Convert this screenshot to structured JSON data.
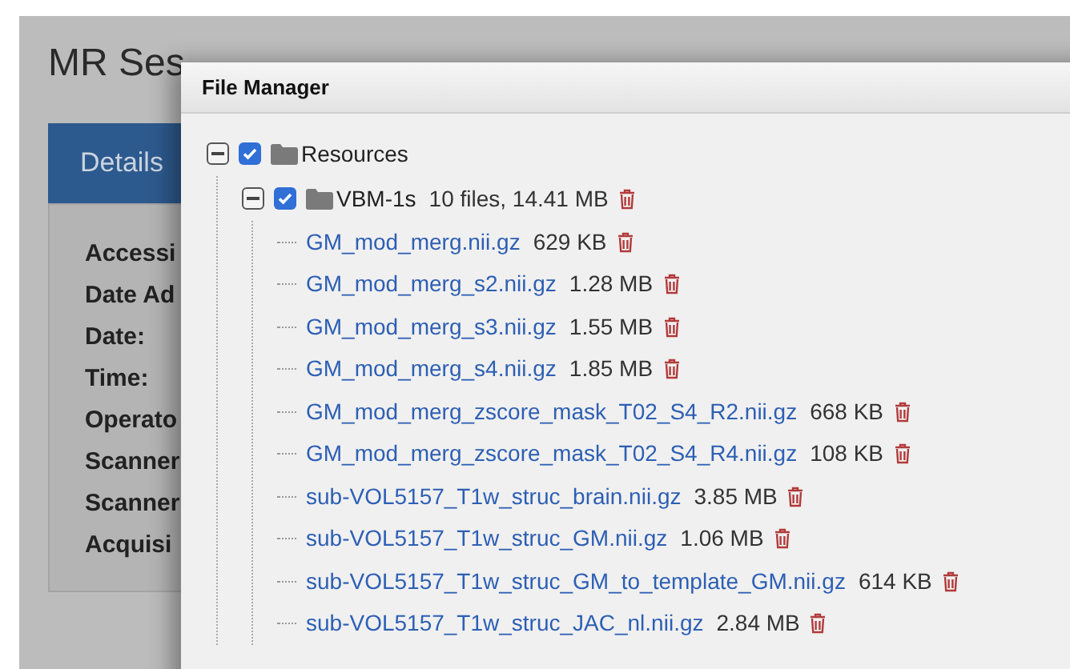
{
  "page": {
    "title": "MR Ses",
    "tabs": [
      {
        "label": "Details",
        "selected": true
      }
    ],
    "field_labels": [
      "Accessi",
      "Date Ad",
      "Date:",
      "Time:",
      "Operato",
      "Scanner",
      "Scanner",
      "Acquisi"
    ]
  },
  "file_manager": {
    "title": "File Manager",
    "tree": [
      {
        "kind": "folder",
        "name": "Resources",
        "expanded": true,
        "checked": true,
        "children": [
          {
            "kind": "folder",
            "name": "VBM-1s",
            "info": "10 files, 14.41 MB",
            "expanded": true,
            "checked": true,
            "children": [
              {
                "kind": "file",
                "name": "GM_mod_merg.nii.gz",
                "size": "629 KB"
              },
              {
                "kind": "file",
                "name": "GM_mod_merg_s2.nii.gz",
                "size": "1.28 MB"
              },
              {
                "kind": "file",
                "name": "GM_mod_merg_s3.nii.gz",
                "size": "1.55 MB"
              },
              {
                "kind": "file",
                "name": "GM_mod_merg_s4.nii.gz",
                "size": "1.85 MB"
              },
              {
                "kind": "file",
                "name": "GM_mod_merg_zscore_mask_T02_S4_R2.nii.gz",
                "size": "668 KB"
              },
              {
                "kind": "file",
                "name": "GM_mod_merg_zscore_mask_T02_S4_R4.nii.gz",
                "size": "108 KB"
              },
              {
                "kind": "file",
                "name": "sub-VOL5157_T1w_struc_brain.nii.gz",
                "size": "3.85 MB"
              },
              {
                "kind": "file",
                "name": "sub-VOL5157_T1w_struc_GM.nii.gz",
                "size": "1.06 MB"
              },
              {
                "kind": "file",
                "name": "sub-VOL5157_T1w_struc_GM_to_template_GM.nii.gz",
                "size": "614 KB"
              },
              {
                "kind": "file",
                "name": "sub-VOL5157_T1w_struc_JAC_nl.nii.gz",
                "size": "2.84 MB"
              }
            ]
          }
        ]
      }
    ]
  }
}
